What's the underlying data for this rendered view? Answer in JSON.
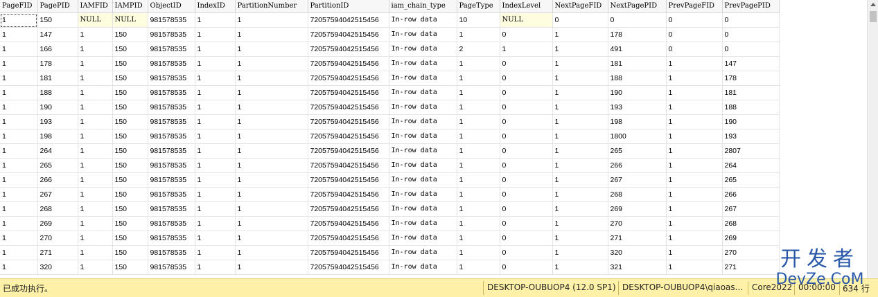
{
  "grid": {
    "columns": [
      "PageFID",
      "PagePID",
      "IAMFID",
      "IAMPID",
      "ObjectID",
      "IndexID",
      "PartitionNumber",
      "PartitionID",
      "iam_chain_type",
      "PageType",
      "IndexLevel",
      "NextPageFID",
      "NextPagePID",
      "PrevPageFID",
      "PrevPagePID"
    ],
    "rows": [
      [
        "1",
        "150",
        "NULL",
        "NULL",
        "981578535",
        "1",
        "1",
        "72057594042515456",
        "In-row data",
        "10",
        "NULL",
        "0",
        "0",
        "0",
        "0"
      ],
      [
        "1",
        "147",
        "1",
        "150",
        "981578535",
        "1",
        "1",
        "72057594042515456",
        "In-row data",
        "1",
        "0",
        "1",
        "178",
        "0",
        "0"
      ],
      [
        "1",
        "166",
        "1",
        "150",
        "981578535",
        "1",
        "1",
        "72057594042515456",
        "In-row data",
        "2",
        "1",
        "1",
        "491",
        "0",
        "0"
      ],
      [
        "1",
        "178",
        "1",
        "150",
        "981578535",
        "1",
        "1",
        "72057594042515456",
        "In-row data",
        "1",
        "0",
        "1",
        "181",
        "1",
        "147"
      ],
      [
        "1",
        "181",
        "1",
        "150",
        "981578535",
        "1",
        "1",
        "72057594042515456",
        "In-row data",
        "1",
        "0",
        "1",
        "188",
        "1",
        "178"
      ],
      [
        "1",
        "188",
        "1",
        "150",
        "981578535",
        "1",
        "1",
        "72057594042515456",
        "In-row data",
        "1",
        "0",
        "1",
        "190",
        "1",
        "181"
      ],
      [
        "1",
        "190",
        "1",
        "150",
        "981578535",
        "1",
        "1",
        "72057594042515456",
        "In-row data",
        "1",
        "0",
        "1",
        "193",
        "1",
        "188"
      ],
      [
        "1",
        "193",
        "1",
        "150",
        "981578535",
        "1",
        "1",
        "72057594042515456",
        "In-row data",
        "1",
        "0",
        "1",
        "198",
        "1",
        "190"
      ],
      [
        "1",
        "198",
        "1",
        "150",
        "981578535",
        "1",
        "1",
        "72057594042515456",
        "In-row data",
        "1",
        "0",
        "1",
        "1800",
        "1",
        "193"
      ],
      [
        "1",
        "264",
        "1",
        "150",
        "981578535",
        "1",
        "1",
        "72057594042515456",
        "In-row data",
        "1",
        "0",
        "1",
        "265",
        "1",
        "2807"
      ],
      [
        "1",
        "265",
        "1",
        "150",
        "981578535",
        "1",
        "1",
        "72057594042515456",
        "In-row data",
        "1",
        "0",
        "1",
        "266",
        "1",
        "264"
      ],
      [
        "1",
        "266",
        "1",
        "150",
        "981578535",
        "1",
        "1",
        "72057594042515456",
        "In-row data",
        "1",
        "0",
        "1",
        "267",
        "1",
        "265"
      ],
      [
        "1",
        "267",
        "1",
        "150",
        "981578535",
        "1",
        "1",
        "72057594042515456",
        "In-row data",
        "1",
        "0",
        "1",
        "268",
        "1",
        "266"
      ],
      [
        "1",
        "268",
        "1",
        "150",
        "981578535",
        "1",
        "1",
        "72057594042515456",
        "In-row data",
        "1",
        "0",
        "1",
        "269",
        "1",
        "267"
      ],
      [
        "1",
        "269",
        "1",
        "150",
        "981578535",
        "1",
        "1",
        "72057594042515456",
        "In-row data",
        "1",
        "0",
        "1",
        "270",
        "1",
        "268"
      ],
      [
        "1",
        "270",
        "1",
        "150",
        "981578535",
        "1",
        "1",
        "72057594042515456",
        "In-row data",
        "1",
        "0",
        "1",
        "271",
        "1",
        "269"
      ],
      [
        "1",
        "271",
        "1",
        "150",
        "981578535",
        "1",
        "1",
        "72057594042515456",
        "In-row data",
        "1",
        "0",
        "1",
        "320",
        "1",
        "270"
      ],
      [
        "1",
        "320",
        "1",
        "150",
        "981578535",
        "1",
        "1",
        "72057594042515456",
        "In-row data",
        "1",
        "0",
        "1",
        "321",
        "1",
        "271"
      ]
    ]
  },
  "statusbar": {
    "message": "已成功执行。",
    "server": "DESKTOP-OUBUOP4 (12.0 SP1)",
    "user": "DESKTOP-OUBUOP4\\qiaoas...",
    "database": "Core2022",
    "elapsed": "00:00:00",
    "row_count": "634 行"
  },
  "watermark": {
    "line1": "开发者",
    "line2": "DevZe.CoM"
  },
  "colors": {
    "status_bg": "#fff1a8",
    "null_cell_bg": "#fffde0",
    "watermark": "#2a58a8"
  }
}
